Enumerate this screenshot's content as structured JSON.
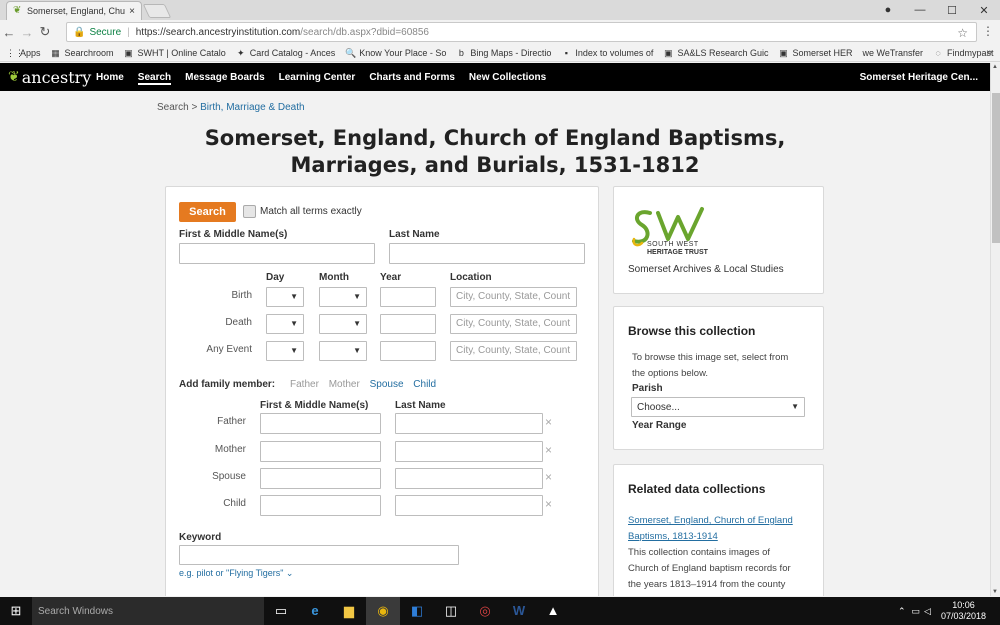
{
  "browser": {
    "tab_title": "Somerset, England, Chur",
    "tab_close": "×",
    "win_min": "—",
    "win_max": "☐",
    "win_close": "✕",
    "win_user": "●",
    "secure_label": "Secure",
    "url_host": "https://search.ancestryinstitution.com",
    "url_path": "/search/db.aspx?dbid=60856",
    "bookmarks": [
      {
        "icon": "⋮⋮",
        "label": "Apps"
      },
      {
        "icon": "▦",
        "label": "Searchroom"
      },
      {
        "icon": "▣",
        "label": "SWHT | Online Catalo"
      },
      {
        "icon": "✦",
        "label": "Card Catalog - Ances"
      },
      {
        "icon": "🔍",
        "label": "Know Your Place - So"
      },
      {
        "icon": "b",
        "label": "Bing Maps - Directio"
      },
      {
        "icon": "▪",
        "label": "Index to volumes of"
      },
      {
        "icon": "▣",
        "label": "SA&LS Research Guic"
      },
      {
        "icon": "▣",
        "label": "Somerset HER"
      },
      {
        "icon": "we",
        "label": "WeTransfer"
      },
      {
        "icon": "◌",
        "label": "Findmypast"
      }
    ],
    "bm_more": "»"
  },
  "header": {
    "logo_text": "ancestry",
    "nav": [
      "Home",
      "Search",
      "Message Boards",
      "Learning Center",
      "Charts and Forms",
      "New Collections"
    ],
    "active_nav": "Search",
    "institution": "Somerset Heritage Cen..."
  },
  "breadcrumb": {
    "root": "Search",
    "sep": " > ",
    "current": "Birth, Marriage & Death"
  },
  "title_line1": "Somerset, England, Church of England Baptisms,",
  "title_line2": "Marriages, and Burials, 1531-1812",
  "form": {
    "search_label": "Search",
    "match_label": "Match all terms exactly",
    "first_name_label": "First & Middle Name(s)",
    "last_name_label": "Last Name",
    "col_day": "Day",
    "col_month": "Month",
    "col_year": "Year",
    "col_location": "Location",
    "events": [
      "Birth",
      "Death",
      "Any Event"
    ],
    "location_placeholder": "City, County, State, Count",
    "family_label": "Add family member:",
    "family_opts": {
      "father": "Father",
      "mother": "Mother",
      "spouse": "Spouse",
      "child": "Child"
    },
    "fam_first_label": "First & Middle Name(s)",
    "fam_last_label": "Last Name",
    "fam_rows": [
      "Father",
      "Mother",
      "Spouse",
      "Child"
    ],
    "remove_glyph": "×",
    "keyword_label": "Keyword",
    "keyword_hint": "e.g. pilot or \"Flying Tigers\" ⌄"
  },
  "sw_card": {
    "text1": "SOUTH WEST",
    "text2": "HERITAGE TRUST",
    "subtitle": "Somerset Archives & Local Studies"
  },
  "browse": {
    "heading": "Browse this collection",
    "desc_line1": "To browse this image set, select from",
    "desc_line2": "the options below.",
    "parish_label": "Parish",
    "parish_value": "Choose...",
    "year_label": "Year Range"
  },
  "related": {
    "heading": "Related data collections",
    "link_line1": "Somerset, England, Church of England",
    "link_line2": "Baptisms, 1813-1914",
    "desc": [
      "This collection contains images of",
      "Church of England baptism records for",
      "the years 1813–1914 from the county"
    ]
  },
  "taskbar": {
    "search_placeholder": "Search Windows",
    "time": "10:06",
    "date": "07/03/2018"
  },
  "colors": {
    "accent_orange": "#e57a20",
    "link_blue": "#236ea1",
    "header_bg": "#000000",
    "sw_green": "#6aa52e"
  }
}
